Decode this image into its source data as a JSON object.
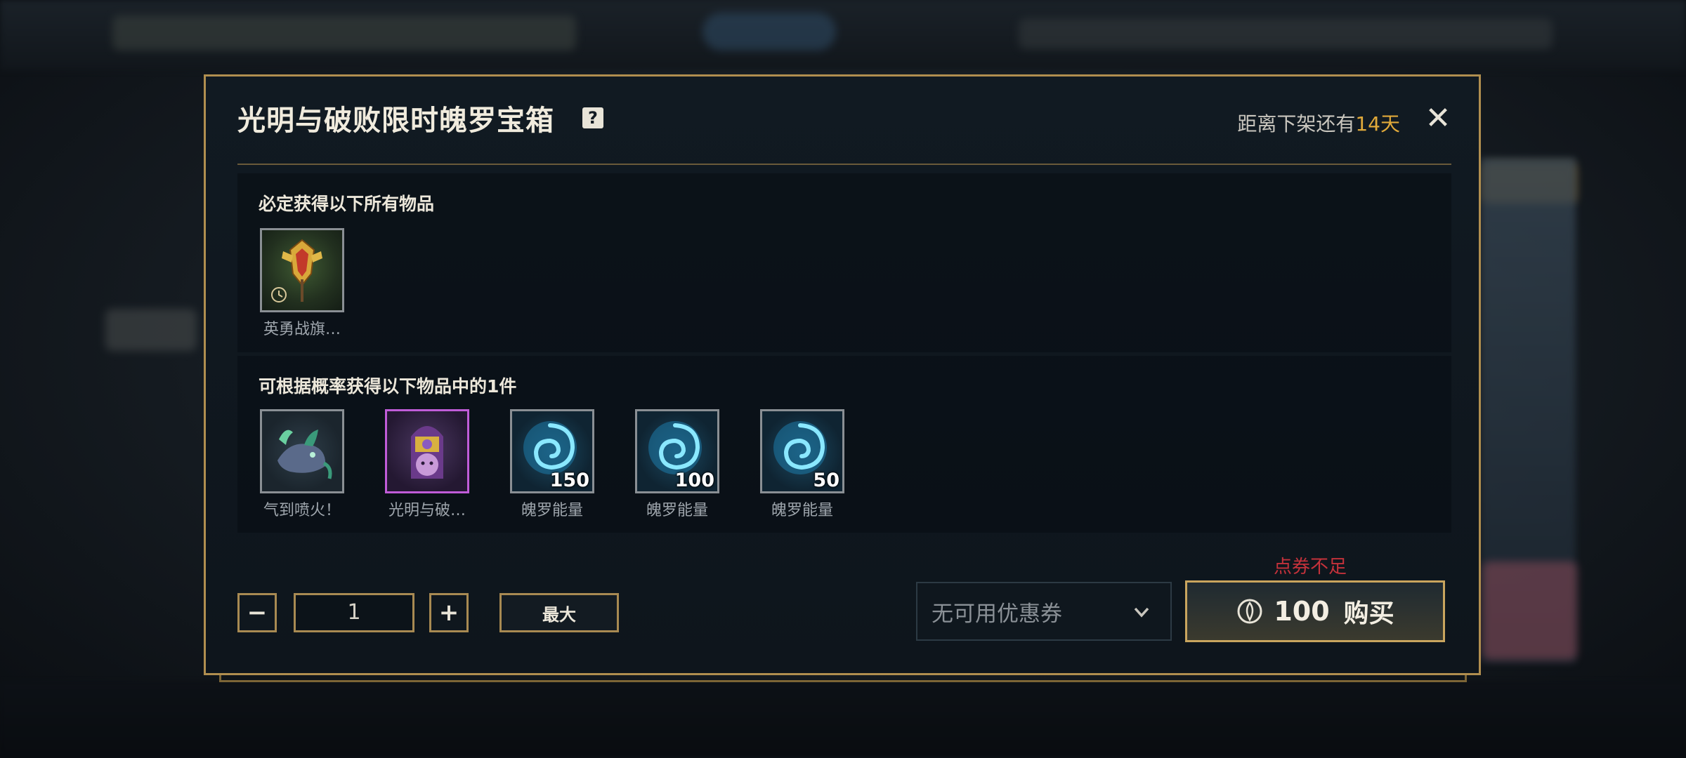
{
  "modal": {
    "title": "光明与破败限时魄罗宝箱",
    "help_symbol": "?",
    "countdown_prefix": "距离下架还有",
    "countdown_days": "14天",
    "close_symbol": "✕"
  },
  "guaranteed": {
    "title": "必定获得以下所有物品",
    "items": [
      {
        "name": "英勇战旗…",
        "icon": "banner-icon"
      }
    ]
  },
  "random": {
    "title": "可根据概率获得以下物品中的1件",
    "items": [
      {
        "name": "气到喷火！",
        "icon": "dragon-icon"
      },
      {
        "name": "光明与破…",
        "icon": "emote-icon"
      },
      {
        "name": "魄罗能量",
        "icon": "poro-energy-icon",
        "quantity": "150"
      },
      {
        "name": "魄罗能量",
        "icon": "poro-energy-icon",
        "quantity": "100"
      },
      {
        "name": "魄罗能量",
        "icon": "poro-energy-icon",
        "quantity": "50"
      }
    ]
  },
  "purchase": {
    "minus_label": "−",
    "plus_label": "+",
    "quantity": "1",
    "max_label": "最大",
    "coupon_text": "无可用优惠券",
    "insufficient_text": "点券不足",
    "price": "100",
    "buy_label": "购买"
  },
  "colors": {
    "gold_border": "#b08e4f",
    "countdown_accent": "#e0a93a",
    "warning_red": "#c4323b",
    "epic_purple": "#c05cd8"
  }
}
